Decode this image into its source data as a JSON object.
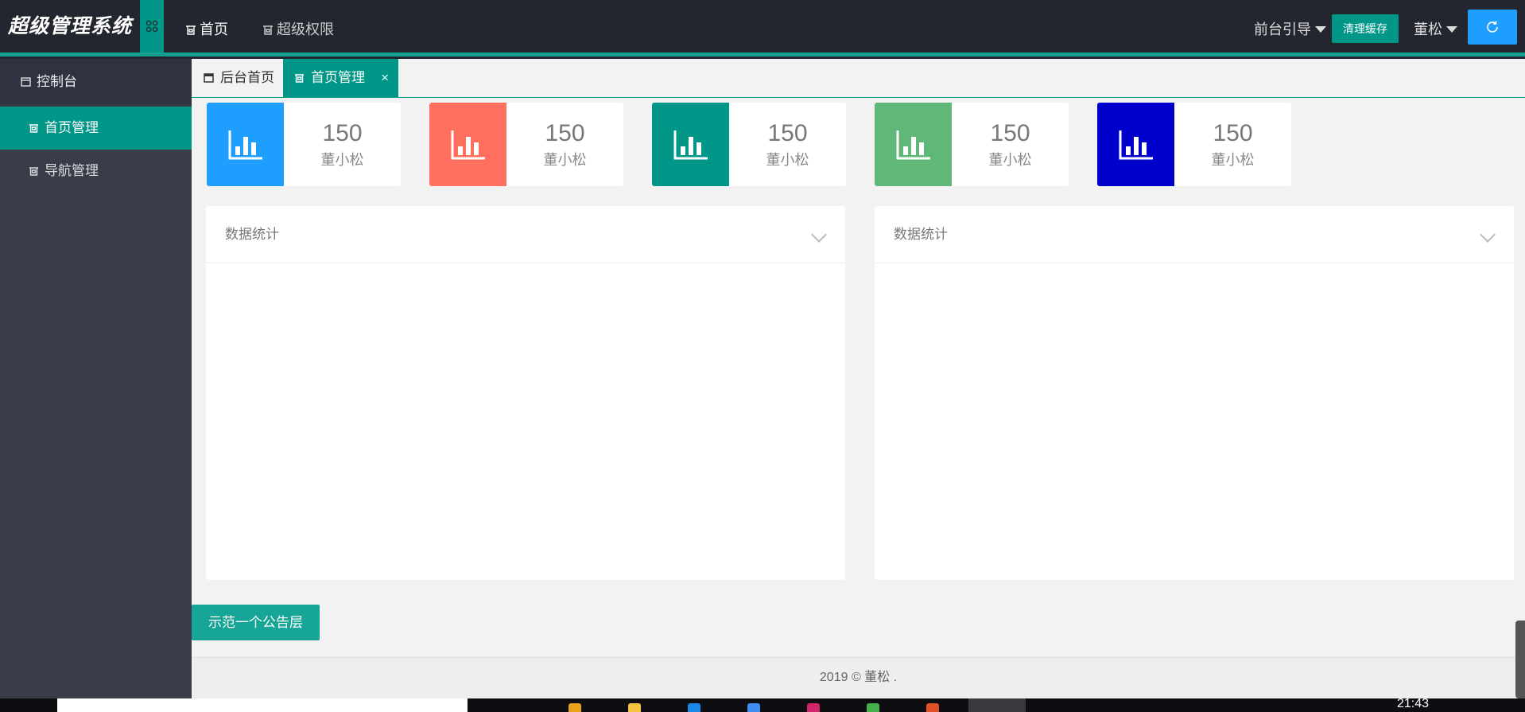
{
  "header": {
    "logo": "超级管理系统",
    "nav": [
      {
        "label": "首页"
      },
      {
        "label": "超级权限"
      }
    ],
    "front_guide": "前台引导",
    "clear_cache": "清理缓存",
    "user": "董松"
  },
  "sidebar": {
    "items": [
      {
        "label": "控制台"
      },
      {
        "label": "首页管理"
      },
      {
        "label": "导航管理"
      }
    ]
  },
  "tabs": [
    {
      "label": "后台首页"
    },
    {
      "label": "首页管理"
    }
  ],
  "tab_close_icon": "×",
  "stats": [
    {
      "value": "150",
      "label": "董小松",
      "color": "#1e9fff"
    },
    {
      "value": "150",
      "label": "董小松",
      "color": "#ff6f5e"
    },
    {
      "value": "150",
      "label": "董小松",
      "color": "#009688"
    },
    {
      "value": "150",
      "label": "董小松",
      "color": "#5fb878"
    },
    {
      "value": "150",
      "label": "董小松",
      "color": "#0000cd"
    }
  ],
  "panels": [
    {
      "title": "数据统计"
    },
    {
      "title": "数据统计"
    }
  ],
  "notice_button": "示范一个公告层",
  "footer": {
    "text": "2019 © 董松 ."
  },
  "taskbar": {
    "clock": "21:43"
  },
  "colors": {
    "accent": "#009688",
    "header_bg": "#23262e",
    "sidebar_bg": "#393d49",
    "blue": "#1e9fff"
  },
  "icons": [
    "grid-icon",
    "home-icon",
    "refresh-icon",
    "bar-chart-icon",
    "chevron-down-icon",
    "close-icon"
  ]
}
